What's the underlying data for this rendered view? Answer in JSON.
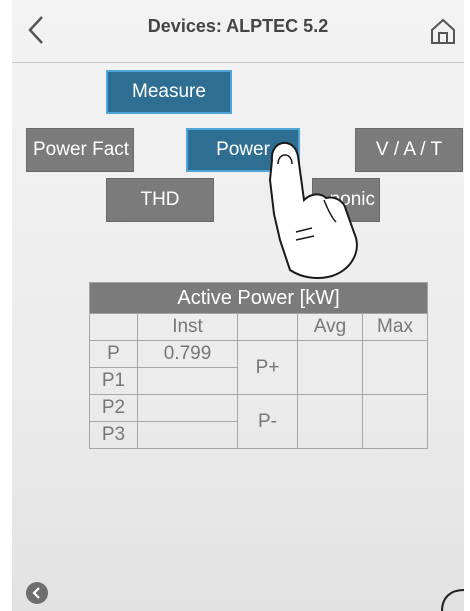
{
  "header": {
    "title": "Devices: ALPTEC 5.2"
  },
  "buttons": {
    "measure": "Measure",
    "power_factor": "Power Fact",
    "power": "Power",
    "vat": "V / A / T",
    "thd": "THD",
    "harmonic": "nonic"
  },
  "table": {
    "title": "Active Power [kW]",
    "columns": [
      "Inst",
      "Avg",
      "Max"
    ],
    "rows": {
      "p": "P",
      "p1": "P1",
      "p2": "P2",
      "p3": "P3"
    },
    "p_inst": "0.799",
    "p_plus": "P+",
    "p_minus": "P-"
  },
  "colors": {
    "selected": "#2f6e93",
    "unselected": "#7b7b7b"
  }
}
